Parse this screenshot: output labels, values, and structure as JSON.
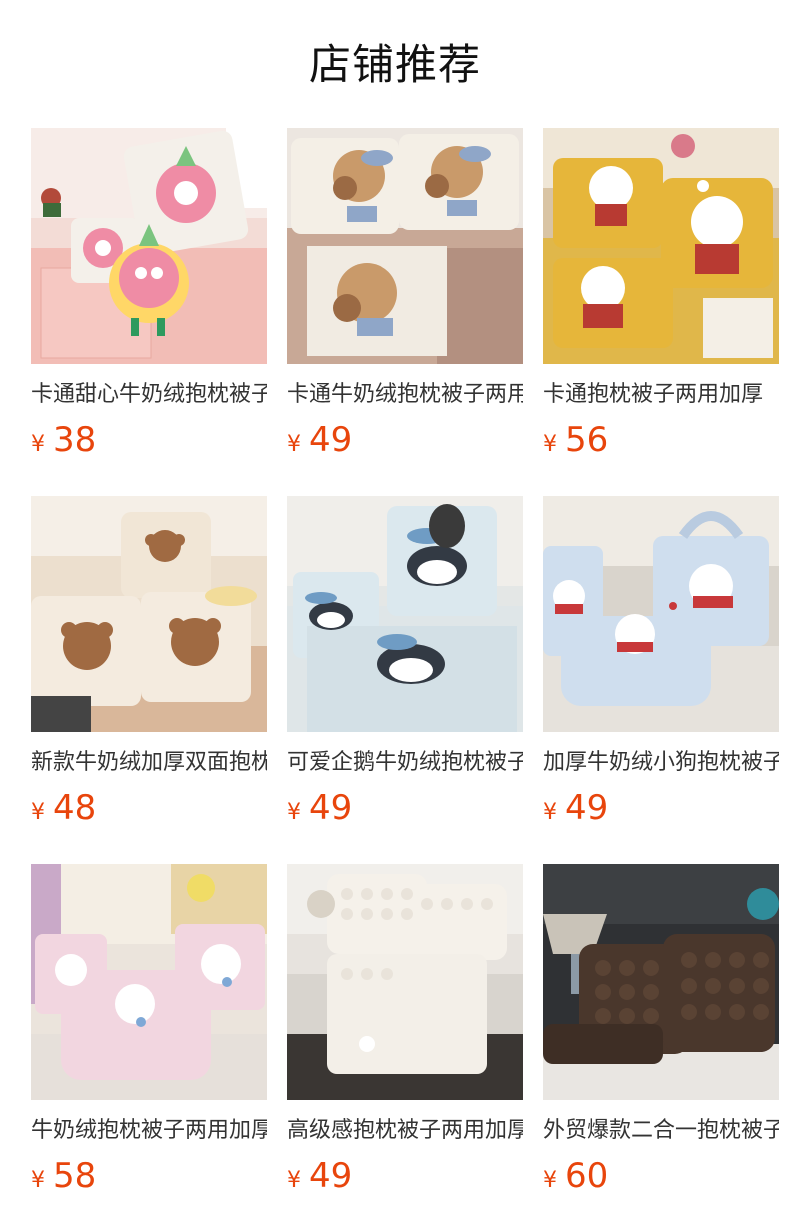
{
  "header": {
    "title": "店铺推荐"
  },
  "colors": {
    "price": "#e8450c",
    "title_text": "#333333"
  },
  "products": [
    {
      "title": "卡通甜心牛奶绒抱枕被子两用",
      "currency": "¥",
      "price": "38",
      "image": "pink-donut-monster-pillow-image"
    },
    {
      "title": "卡通牛奶绒抱枕被子两用加厚",
      "currency": "¥",
      "price": "49",
      "image": "bear-pillow-blanket-image"
    },
    {
      "title": "卡通抱枕被子两用加厚",
      "currency": "¥",
      "price": "56",
      "image": "yellow-dog-pillow-image"
    },
    {
      "title": "新款牛奶绒加厚双面抱枕被",
      "currency": "¥",
      "price": "48",
      "image": "brown-bear-pillow-image"
    },
    {
      "title": "可爱企鹅牛奶绒抱枕被子",
      "currency": "¥",
      "price": "49",
      "image": "penguin-pillow-image"
    },
    {
      "title": "加厚牛奶绒小狗抱枕被子",
      "currency": "¥",
      "price": "49",
      "image": "blue-dot-puppy-pillow-image"
    },
    {
      "title": "牛奶绒抱枕被子两用加厚",
      "currency": "¥",
      "price": "58",
      "image": "pink-dot-puppy-pillow-image"
    },
    {
      "title": "高级感抱枕被子两用加厚",
      "currency": "¥",
      "price": "49",
      "image": "cream-bubble-pillow-image"
    },
    {
      "title": "外贸爆款二合一抱枕被子",
      "currency": "¥",
      "price": "60",
      "image": "brown-bubble-pillow-image"
    }
  ]
}
